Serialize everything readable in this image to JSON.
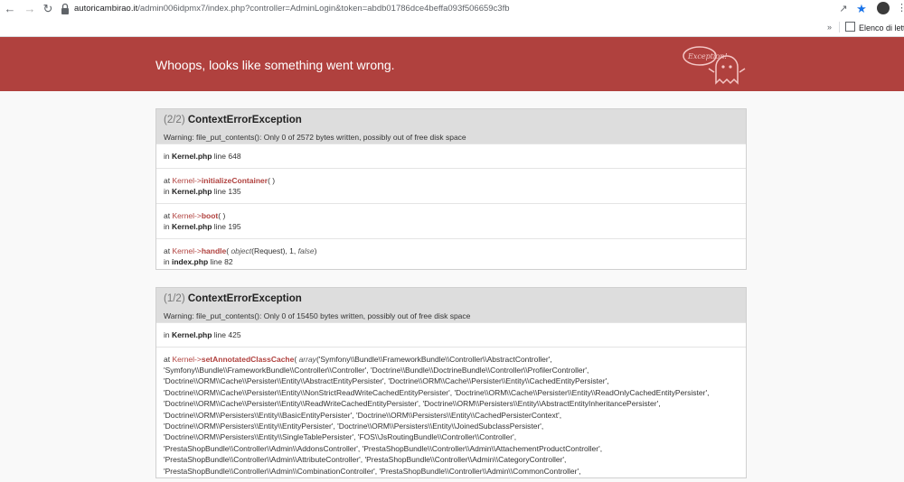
{
  "browser": {
    "url_host": "autoricambirao.it",
    "url_path": "/admin006idpmx7/index.php?controller=AdminLogin&token=abdb01786dce4beffa093f506659c3fb",
    "bookmarks_more": "»",
    "reading_list_label": "Elenco di lettura",
    "icons": [
      "back-icon",
      "forward-icon",
      "reload-icon",
      "lock-icon",
      "share-icon",
      "star-icon",
      "extensions-icon",
      "profile-avatar",
      "menu-icon"
    ]
  },
  "header": {
    "title": "Whoops, looks like something went wrong.",
    "ghost_label": "Exception!",
    "bg_color": "#b0413e"
  },
  "exceptions": [
    {
      "counter": "(2/2)",
      "name": "ContextErrorException",
      "message": "Warning: file_put_contents(): Only 0 of 2572 bytes written, possibly out of free disk space",
      "traces": [
        {
          "file": "Kernel.php",
          "line": "648"
        },
        {
          "class": "Kernel",
          "method": "initializeContainer",
          "args": "",
          "file": "Kernel.php",
          "line": "135"
        },
        {
          "class": "Kernel",
          "method": "boot",
          "args": "",
          "file": "Kernel.php",
          "line": "195"
        },
        {
          "class": "Kernel",
          "method": "handle",
          "arg_obj": "object",
          "arg_obj_val": "(Request), 1, ",
          "arg_false": "false",
          "file": "index.php",
          "line": "82"
        }
      ]
    },
    {
      "counter": "(1/2)",
      "name": "ContextErrorException",
      "message": "Warning: file_put_contents(): Only 0 of 15450 bytes written, possibly out of free disk space",
      "traces": [
        {
          "file": "Kernel.php",
          "line": "425"
        },
        {
          "class": "Kernel",
          "method": "setAnnotatedClassCache",
          "arg_array": "array",
          "arg_lines": [
            "('Symfony\\\\Bundle\\\\FrameworkBundle\\\\Controller\\\\AbstractController',",
            "'Symfony\\\\Bundle\\\\FrameworkBundle\\\\Controller\\\\Controller', 'Doctrine\\\\Bundle\\\\DoctrineBundle\\\\Controller\\\\ProfilerController',",
            "'Doctrine\\\\ORM\\\\Cache\\\\Persister\\\\Entity\\\\AbstractEntityPersister', 'Doctrine\\\\ORM\\\\Cache\\\\Persister\\\\Entity\\\\CachedEntityPersister',",
            "'Doctrine\\\\ORM\\\\Cache\\\\Persister\\\\Entity\\\\NonStrictReadWriteCachedEntityPersister', 'Doctrine\\\\ORM\\\\Cache\\\\Persister\\\\Entity\\\\ReadOnlyCachedEntityPersister',",
            "'Doctrine\\\\ORM\\\\Cache\\\\Persister\\\\Entity\\\\ReadWriteCachedEntityPersister', 'Doctrine\\\\ORM\\\\Persisters\\\\Entity\\\\AbstractEntityInheritancePersister',",
            "'Doctrine\\\\ORM\\\\Persisters\\\\Entity\\\\BasicEntityPersister', 'Doctrine\\\\ORM\\\\Persisters\\\\Entity\\\\CachedPersisterContext',",
            "'Doctrine\\\\ORM\\\\Persisters\\\\Entity\\\\EntityPersister', 'Doctrine\\\\ORM\\\\Persisters\\\\Entity\\\\JoinedSubclassPersister',",
            "'Doctrine\\\\ORM\\\\Persisters\\\\Entity\\\\SingleTablePersister', 'FOS\\\\JsRoutingBundle\\\\Controller\\\\Controller',",
            "'PrestaShopBundle\\\\Controller\\\\Admin\\\\AddonsController', 'PrestaShopBundle\\\\Controller\\\\Admin\\\\AttachementProductController',",
            "'PrestaShopBundle\\\\Controller\\\\Admin\\\\AttributeController', 'PrestaShopBundle\\\\Controller\\\\Admin\\\\CategoryController',",
            "'PrestaShopBundle\\\\Controller\\\\Admin\\\\CombinationController', 'PrestaShopBundle\\\\Controller\\\\Admin\\\\CommonController',"
          ]
        }
      ]
    }
  ],
  "labels": {
    "at": "at",
    "in": "in",
    "line": "line",
    "arrow": "->"
  }
}
